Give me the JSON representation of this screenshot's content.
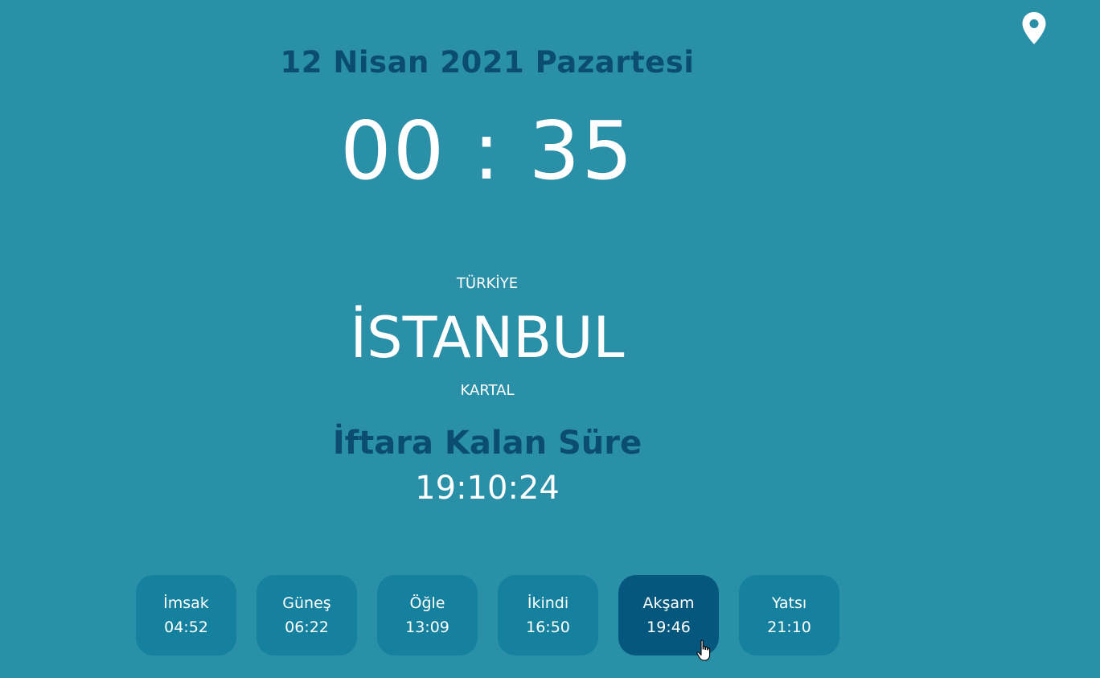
{
  "header": {
    "date": "12 Nisan 2021 Pazartesi",
    "clock": "00 : 35",
    "location_icon": "location-pin-icon"
  },
  "location": {
    "country": "TÜRKİYE",
    "city": "İSTANBUL",
    "district": "KARTAL"
  },
  "countdown": {
    "label": "İftara Kalan Süre",
    "value": "19:10:24"
  },
  "prayer_times": [
    {
      "name": "İmsak",
      "time": "04:52"
    },
    {
      "name": "Güneş",
      "time": "06:22"
    },
    {
      "name": "Öğle",
      "time": "13:09"
    },
    {
      "name": "İkindi",
      "time": "16:50"
    },
    {
      "name": "Akşam",
      "time": "19:46"
    },
    {
      "name": "Yatsı",
      "time": "21:10"
    }
  ],
  "selected_prayer": "Akşam",
  "colors": {
    "background": "#2a90a8",
    "accent_dark": "#0b4d72",
    "card": "#15819e",
    "card_active": "#06577d",
    "text": "#ffffff"
  }
}
